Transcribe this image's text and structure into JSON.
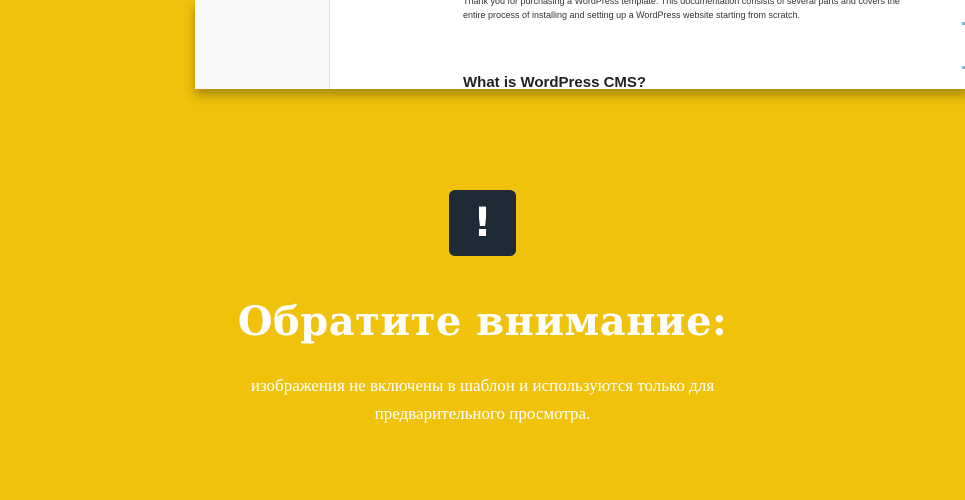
{
  "doc_preview": {
    "intro_line1": "Thank you for purchasing a WordPress template. This documentation consists of several parts and covers the",
    "intro_line2": "entire process of installing and setting up a WordPress website starting from scratch.",
    "heading": "What is WordPress CMS?"
  },
  "notice": {
    "icon_glyph": "!",
    "icon_name": "exclamation-icon",
    "title": "Обратите внимание:",
    "text": "изображения не включены в шаблон и используются только для предварительного просмотра."
  },
  "colors": {
    "background": "#f0c20b",
    "icon_background": "#1e2a35",
    "text": "#ffffff"
  }
}
